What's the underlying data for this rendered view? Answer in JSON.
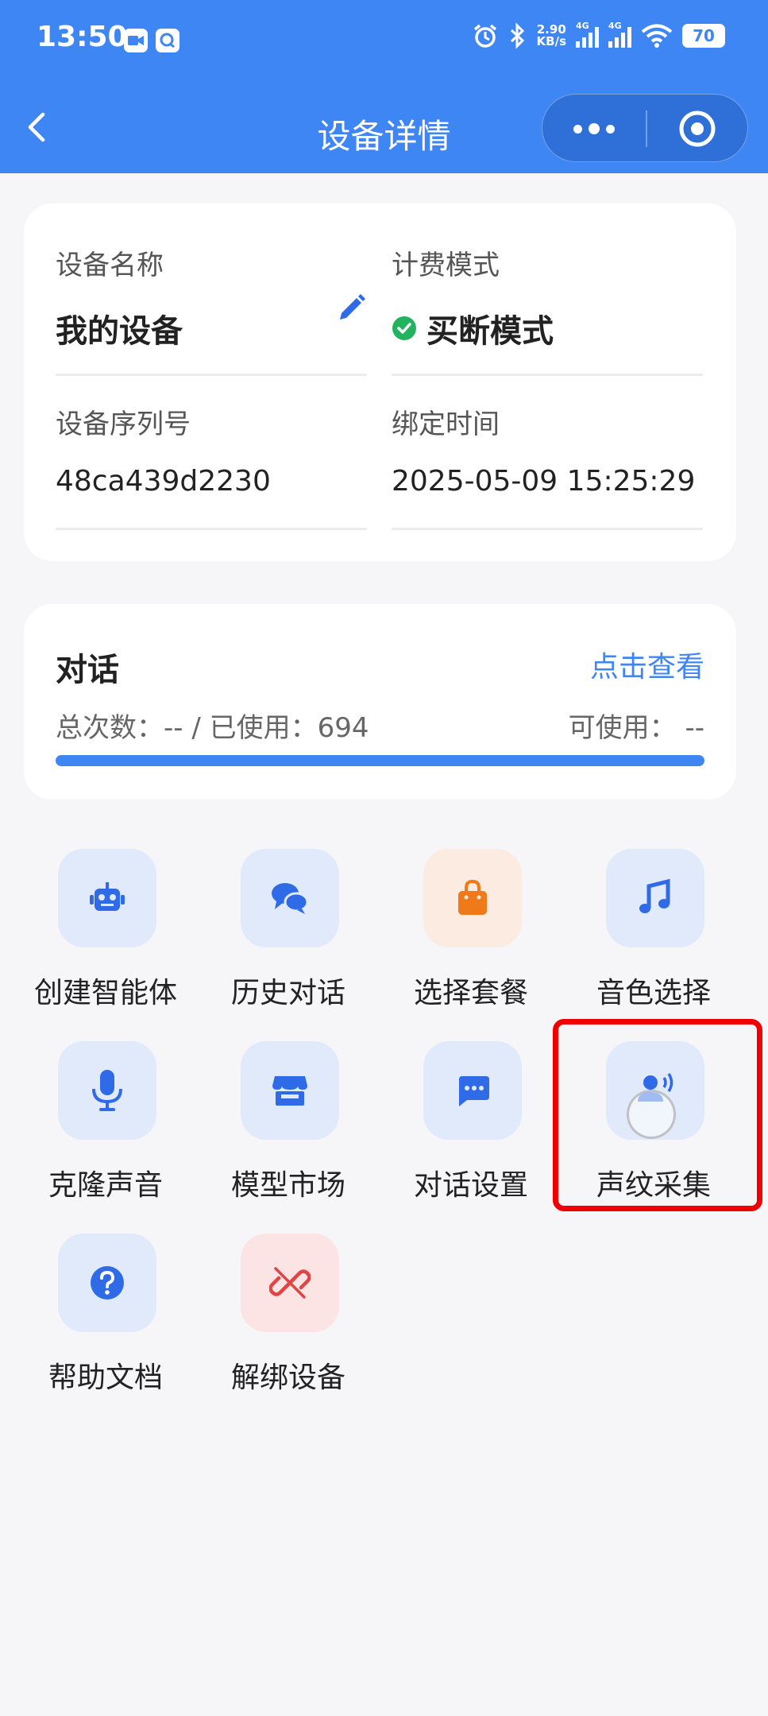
{
  "status_bar": {
    "time": "13:50",
    "net_speed_value": "2.90",
    "net_speed_unit": "KB/s",
    "signal1_label": "4G",
    "signal2_label": "4G",
    "battery": "70",
    "icons": [
      "video-icon",
      "chat-app-icon",
      "alarm-icon",
      "bluetooth-icon",
      "wifi-icon"
    ]
  },
  "nav": {
    "title": "设备详情",
    "icons": [
      "back-chevron-icon",
      "more-icon",
      "close-target-icon"
    ]
  },
  "device_info": {
    "name_label": "设备名称",
    "name_value": "我的设备",
    "billing_label": "计费模式",
    "billing_value": "买断模式",
    "serial_label": "设备序列号",
    "serial_value": "48ca439d2230",
    "bind_label": "绑定时间",
    "bind_value": "2025-05-09 15:25:29"
  },
  "dialog": {
    "title": "对话",
    "link": "点击查看",
    "usage_left": "总次数：-- / 已使用：694",
    "usage_right": "可使用： --",
    "progress": 1.0
  },
  "menu": [
    {
      "label": "创建智能体",
      "icon": "robot-icon",
      "color": "#2f6be6"
    },
    {
      "label": "历史对话",
      "icon": "chat-bubbles-icon",
      "color": "#2f6be6"
    },
    {
      "label": "选择套餐",
      "icon": "shopping-bag-icon",
      "color": "#f07a1a"
    },
    {
      "label": "音色选择",
      "icon": "music-note-icon",
      "color": "#2f6be6"
    },
    {
      "label": "克隆声音",
      "icon": "microphone-icon",
      "color": "#2f6be6"
    },
    {
      "label": "模型市场",
      "icon": "store-icon",
      "color": "#2f6be6"
    },
    {
      "label": "对话设置",
      "icon": "message-dots-icon",
      "color": "#2f6be6"
    },
    {
      "label": "声纹采集",
      "icon": "voice-print-icon",
      "color": "#2f6be6"
    },
    {
      "label": "帮助文档",
      "icon": "help-icon",
      "color": "#2f6be6"
    },
    {
      "label": "解绑设备",
      "icon": "unlink-icon",
      "color": "#e04444"
    }
  ],
  "colors": {
    "primary": "#3e86f3",
    "highlight_border": "#f00000",
    "success": "#22b35e"
  }
}
